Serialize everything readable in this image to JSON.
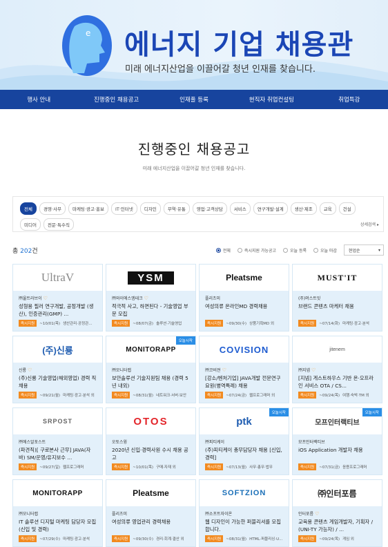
{
  "hero": {
    "title": "에너지 기업 채용관",
    "subtitle": "미래 에너지산업을 이끌어갈 청년 인재를 찾습니다."
  },
  "nav": [
    "행사 안내",
    "진행중인 채용공고",
    "인재풀 등록",
    "현직자 취업컨설팅",
    "취업특강"
  ],
  "page": {
    "title": "진행중인 채용공고",
    "subtitle": "미래 에너지산업을 이끌어갈 청년 인재를 찾습니다."
  },
  "filters": {
    "chips": [
      "전체",
      "경영·사무",
      "마케팅·광고·홍보",
      "IT·인터넷",
      "디자인",
      "무역·유통",
      "영업·고객상담",
      "서비스",
      "연구개발·설계",
      "생산·제조",
      "교육",
      "건설",
      "미디어",
      "전문·특수직"
    ],
    "active": "전체",
    "more_label": "상세검색"
  },
  "list": {
    "total_prefix": "총 ",
    "total_count": "202",
    "total_suffix": "건",
    "radios": [
      "전체",
      "즉시지원 가능공고",
      "오늘 등록",
      "오늘 마감"
    ],
    "sort": "현업순"
  },
  "cards": [
    {
      "logo": "UltraV",
      "company": "㈜울트라브이",
      "heart": true,
      "title": "성형용 필러 연구개발, 공정개발 (생산), 인증관리(GMP) ...",
      "tag": "즉시지원",
      "date": "~10/01(목)",
      "extra": "생산관리·공정관...",
      "badge": ""
    },
    {
      "logo": "YSM",
      "company": "㈜와이에스엠테크",
      "heart": true,
      "title": "적극적 사고, 하면된다 - 기술영업 부문 모집",
      "tag": "즉시지원",
      "date": "~08/07(금)",
      "extra": "솔루션·기술영업",
      "badge": ""
    },
    {
      "logo": "Pleatsme",
      "company": "플리츠미",
      "heart": false,
      "title": "여성의류 온라인MD 경력채용",
      "tag": "즉시지원",
      "date": "~09/30(수)",
      "extra": "상품기획MD 외",
      "badge": ""
    },
    {
      "logo": "MUST'IT",
      "company": "(주)머스트잇",
      "heart": false,
      "title": "브랜드 콘텐츠 마케터 채용",
      "tag": "즉시지원",
      "date": "~07/14(화)",
      "extra": "마케팅·광고·분석",
      "badge": ""
    },
    {
      "logo": "(주)신룡",
      "company": "신룡",
      "heart": true,
      "title": "(주)신룡 기술영업(해외영업) 경력 직 채용",
      "tag": "즉시지원",
      "date": "~09/21(월)",
      "extra": "마케팅·광고·분석 외",
      "badge": ""
    },
    {
      "logo": "MONITORAPP",
      "company": "㈜모니터랩",
      "heart": false,
      "title": "보안솔루션 기술지원팀 채용 (경력 5년 내외)",
      "tag": "즉시지원",
      "date": "~08/31(월)",
      "extra": "네트워크·서버·보안",
      "badge": "오늘시작"
    },
    {
      "logo": "COVISION",
      "company": "㈜코비젼",
      "heart": true,
      "title": "[강소/벤처기업] JAVA개발 전문연구요원(병역특례) 채용",
      "tag": "즉시지원",
      "date": "~07/24(금)",
      "extra": "웹프로그래머 외",
      "badge": ""
    },
    {
      "logo": "jitenem",
      "company": "㈜지넴",
      "heart": true,
      "title": "[지넴] 게스트하우스 기반 온·오프라인 서비스 OTA / CS...",
      "tag": "즉시지원",
      "date": "~09/24(목)",
      "extra": "여행·숙박·TM 외",
      "badge": ""
    },
    {
      "logo": "SRPOST",
      "company": "㈜에스알포스트",
      "heart": false,
      "title": "(파견직)[ 구로본사 근무] JAVA(자바) SM/운영/유지보수 ...",
      "tag": "즉시지원",
      "date": "~09/27(일)",
      "extra": "웹프로그래머",
      "badge": ""
    },
    {
      "logo": "OTOS",
      "company": "오토스윙",
      "heart": false,
      "title": "2020년 신입·경력사원 수시 채용 공고",
      "tag": "즉시지원",
      "date": "~10/01(목)",
      "extra": "구매·자재 외",
      "badge": ""
    },
    {
      "logo": "ptk",
      "company": "㈜피티케이",
      "heart": false,
      "title": "(주)피티케이 총무담당자 채용 [신입, 경력]",
      "tag": "즉시지원",
      "date": "~07/13(월)",
      "extra": "사무·총무·법무",
      "badge": "오늘시작"
    },
    {
      "logo": "모프인터랙티브",
      "company": "모프인터랙티브",
      "heart": false,
      "title": "iOS Application 개발자 채용",
      "tag": "즉시지원",
      "date": "~07/31(금)",
      "extra": "응용프로그래머",
      "badge": "오늘시작"
    },
    {
      "logo": "MONITORAPP",
      "company": "㈜모니터랩",
      "heart": false,
      "title": "IT 솔루션 디지털 마케팅 담당자 모집 (신입 및 경력)",
      "tag": "즉시지원",
      "date": "~07/29(수)",
      "extra": "마케팅·광고·분석",
      "badge": ""
    },
    {
      "logo": "Pleatsme",
      "company": "플리츠미",
      "heart": false,
      "title": "여성의류 영업관리 경력채용",
      "tag": "즉시지원",
      "date": "~09/30(수)",
      "extra": "경리·회계·결산 외",
      "badge": ""
    },
    {
      "logo": "SOFTZION",
      "company": "㈜소프트자이온",
      "heart": false,
      "title": "웹 디자인이 가능한 퍼블리셔를 모집합니다.",
      "tag": "즉시지원",
      "date": "~08/31(월)",
      "extra": "HTML·퍼블리싱·U...",
      "badge": ""
    },
    {
      "logo": "㈜인터포름",
      "company": "인터포름",
      "heart": true,
      "title": "교육용 콘텐츠 게임개발자, 기획자 / (UNI-TY 가능자) / ...",
      "tag": "즉시지원",
      "date": "~09/24(목)",
      "extra": "게임 외",
      "badge": ""
    }
  ],
  "colors": {
    "nav": "#17449e",
    "accent": "#1b6fd1",
    "tag": "#f28a1f",
    "card": "#e3f0fa"
  }
}
